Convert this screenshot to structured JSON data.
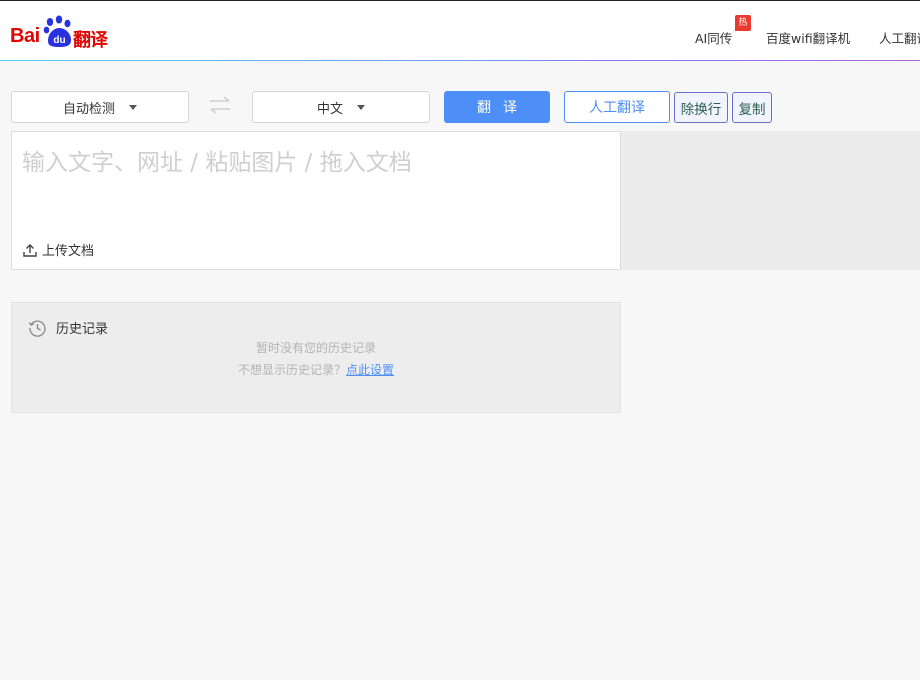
{
  "header": {
    "logo_bai": "Bai",
    "logo_du": "du",
    "logo_product": "翻译",
    "nav": [
      {
        "label": "AI同传",
        "badge": "热"
      },
      {
        "label": "百度wifi翻译机"
      },
      {
        "label": "人工翻译"
      }
    ]
  },
  "toolbar": {
    "source_lang": "自动检测",
    "target_lang": "中文",
    "translate_label": "翻译",
    "human_translate_label": "人工翻译",
    "remove_linebreaks_label": "除换行",
    "copy_label": "复制"
  },
  "input": {
    "placeholder": "输入文字、网址 / 粘贴图片 / 拖入文档",
    "upload_label": "上传文档"
  },
  "history": {
    "title": "历史记录",
    "empty_text": "暂时没有您的历史记录",
    "hint_text": "不想显示历史记录？",
    "settings_link": "点此设置"
  },
  "colors": {
    "brand_red": "#e10602",
    "brand_blue": "#2932e1",
    "accent_blue": "#4e8ef7",
    "hot_badge": "#e83a2f"
  }
}
